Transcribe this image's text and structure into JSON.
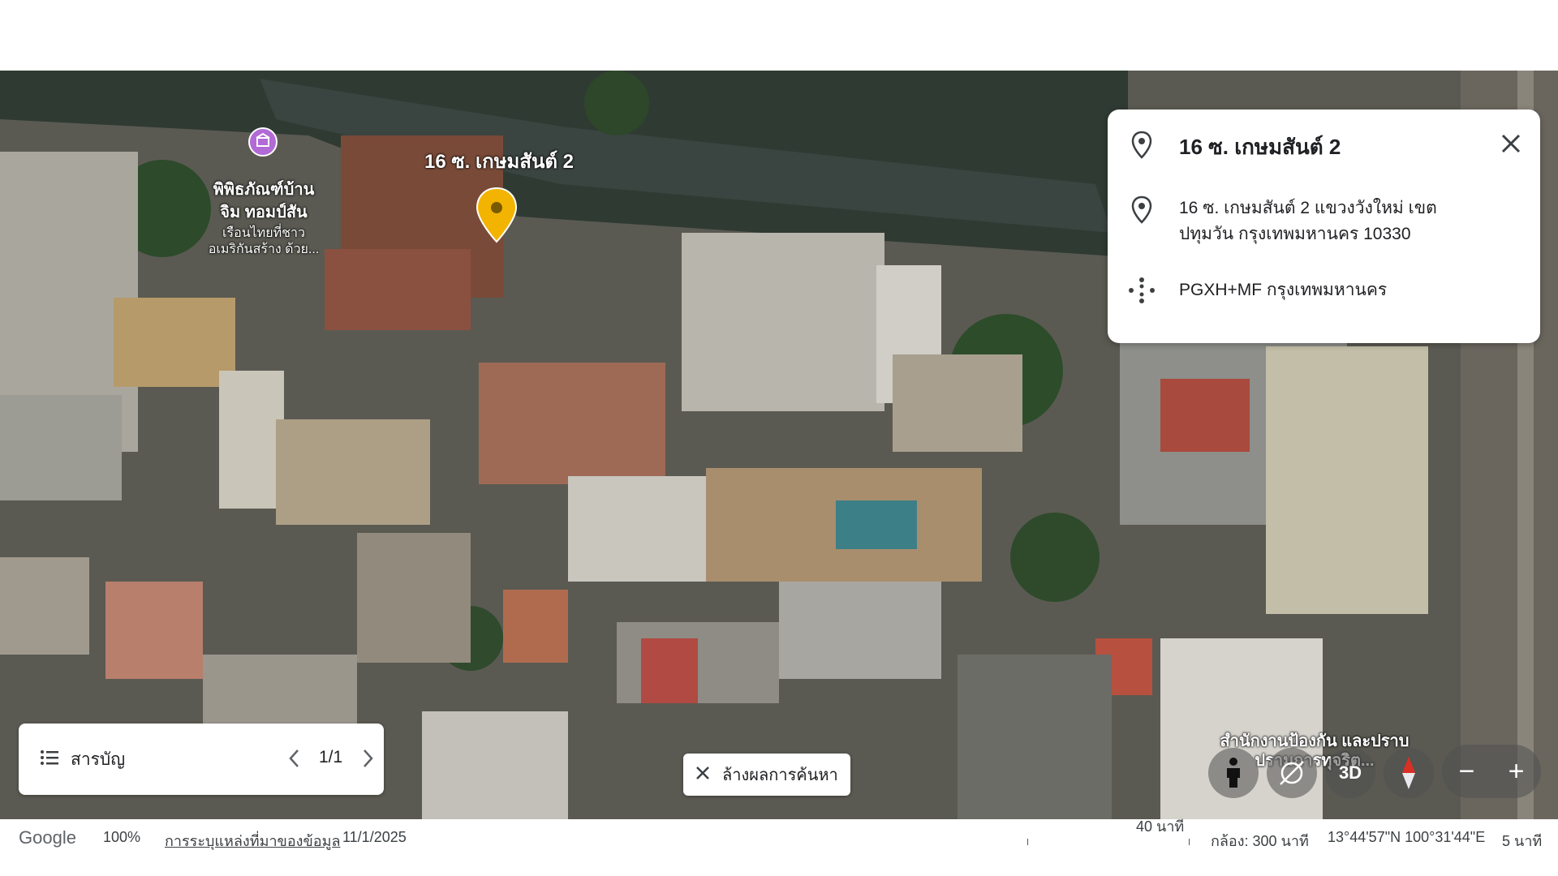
{
  "map": {
    "poi_name": "พิพิธภัณฑ์บ้าน จิม ทอมป์สัน",
    "poi_description": "เรือนไทยที่ชาวอเมริกันสร้าง ด้วย...",
    "pin_label": "16 ซ. เกษมสันต์ 2",
    "corner_label": "สำนักงานป้องกัน และปราบปรามการทุจริต...",
    "icons": [
      "museum-icon",
      "location-pin-icon"
    ]
  },
  "place_card": {
    "title": "16 ซ. เกษมสันต์ 2",
    "address": "16 ซ. เกษมสันต์ 2 แขวงวังใหม่ เขตปทุมวัน กรุงเทพมหานคร 10330",
    "plus_code": "PGXH+MF กรุงเทพมหานคร",
    "icons": [
      "place-icon",
      "address-pin-icon",
      "plus-code-icon",
      "close-icon"
    ]
  },
  "toc": {
    "label": "สารบัญ",
    "page": "1/1",
    "icons": [
      "list-icon",
      "chevron-left-icon",
      "chevron-right-icon"
    ]
  },
  "clear_results": {
    "label": "ล้างผลการค้นหา"
  },
  "controls": {
    "view_3d": "3D",
    "zoom_out": "−",
    "zoom_in": "+",
    "icons": [
      "street-view-icon",
      "tilt-icon",
      "compass-icon"
    ]
  },
  "status_bar": {
    "logo": "Google",
    "zoom": "100%",
    "attribution": "การระบุแหล่งที่มาของข้อมูล",
    "date": "11/1/2025",
    "scale": "40 นาที",
    "camera": "กล้อง: 300 นาที",
    "coordinates": "13°44'57\"N 100°31'44\"E",
    "elevation": "5 นาที"
  },
  "colors": {
    "pin": "#f2b400",
    "poi": "#b26ad6",
    "card_bg": "#ffffff"
  }
}
